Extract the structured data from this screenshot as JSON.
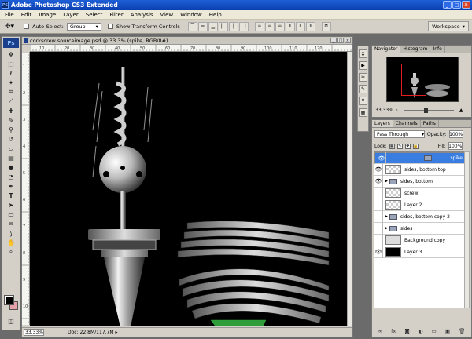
{
  "titlebar": {
    "app_icon": "PS",
    "title": "Adobe Photoshop CS3 Extended",
    "min": "_",
    "max": "□",
    "close": "×"
  },
  "menu": [
    "File",
    "Edit",
    "Image",
    "Layer",
    "Select",
    "Filter",
    "Analysis",
    "View",
    "Window",
    "Help"
  ],
  "options": {
    "auto_select_label": "Auto-Select:",
    "auto_select_value": "Group",
    "show_transform_label": "Show Transform Controls",
    "workspace_label": "Workspace"
  },
  "toolbox": {
    "logo": "Ps"
  },
  "document": {
    "title": "corkscrew sourceimage.psd @ 33.3% (spike, RGB/8#)",
    "zoom": "33.33%",
    "doc_label": "Doc:",
    "doc_size": "22.8M/117.7M",
    "ruler_ticks": [
      "10",
      "20",
      "30",
      "40",
      "50",
      "60",
      "70",
      "80",
      "90",
      "100",
      "110",
      "120"
    ],
    "vruler_ticks": [
      "1",
      "2",
      "3",
      "4",
      "5",
      "6",
      "7",
      "8",
      "9",
      "10"
    ]
  },
  "navigator": {
    "tabs": [
      "Navigator",
      "Histogram",
      "Info"
    ],
    "zoom": "33.33%"
  },
  "layers": {
    "tabs": [
      "Layers",
      "Channels",
      "Paths"
    ],
    "blend_mode": "Pass Through",
    "opacity_label": "Opacity:",
    "opacity": "100%",
    "lock_label": "Lock:",
    "fill_label": "Fill:",
    "fill": "100%",
    "items": [
      {
        "name": "spike",
        "type": "folder",
        "visible": true,
        "selected": true,
        "expand": ""
      },
      {
        "name": "sides, bottom top",
        "type": "layer",
        "visible": true,
        "selected": false,
        "thumb": "checker"
      },
      {
        "name": "sides, bottom",
        "type": "folder",
        "visible": true,
        "selected": false,
        "expand": "▶"
      },
      {
        "name": "screw",
        "type": "layer",
        "visible": false,
        "selected": false,
        "thumb": "checker"
      },
      {
        "name": "Layer 2",
        "type": "layer",
        "visible": false,
        "selected": false,
        "thumb": "checker"
      },
      {
        "name": "sides, bottom copy 2",
        "type": "folder",
        "visible": false,
        "selected": false,
        "expand": "▶"
      },
      {
        "name": "sides",
        "type": "folder",
        "visible": false,
        "selected": false,
        "expand": "▶"
      },
      {
        "name": "Background copy",
        "type": "layer",
        "visible": false,
        "selected": false,
        "thumb": "checker"
      },
      {
        "name": "Layer 3",
        "type": "layer",
        "visible": true,
        "selected": false,
        "thumb": "black"
      }
    ],
    "footer": [
      "∞",
      "fx",
      "◙",
      "◐",
      "▭",
      "▣",
      "🗑"
    ]
  },
  "colors": {
    "foreground": "#000000",
    "background": "#e6a2a8",
    "accent": "#3a7de0"
  }
}
